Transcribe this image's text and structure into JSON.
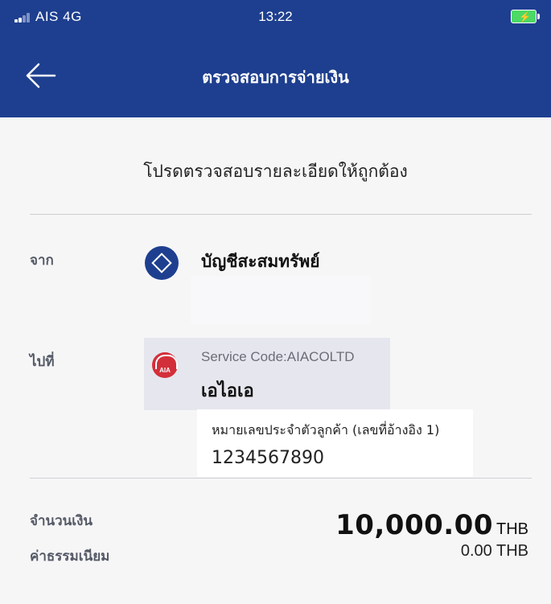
{
  "status_bar": {
    "carrier": "AIS  4G",
    "time": "13:22",
    "battery_icon": "battery-charging-icon",
    "signal_icon": "signal-icon",
    "battery_color": "#4cd964"
  },
  "nav": {
    "title": "ตรวจสอบการจ่ายเงิน",
    "back_icon": "arrow-left-icon",
    "background_color": "#1e3f8f"
  },
  "instruction": "โปรดตรวจสอบรายละเอียดให้ถูกต้อง",
  "from": {
    "label": "จาก",
    "account_name": "บัญชีสะสมทรัพย์",
    "account_icon": "diamond-bank-icon"
  },
  "to": {
    "label": "ไปที่",
    "service_code": "Service Code:AIACOLTD",
    "payee_name": "เอไอเอ",
    "logo_icon": "aia-logo",
    "logo_text": "AIA"
  },
  "reference": {
    "label": "หมายเลขประจำตัวลูกค้า (เลขที่อ้างอิง 1)",
    "value": "1234567890"
  },
  "amount": {
    "label": "จำนวนเงิน",
    "value": "10,000.00",
    "currency": "THB"
  },
  "fee": {
    "label": "ค่าธรรมเนียม",
    "value": "0.00 THB"
  }
}
